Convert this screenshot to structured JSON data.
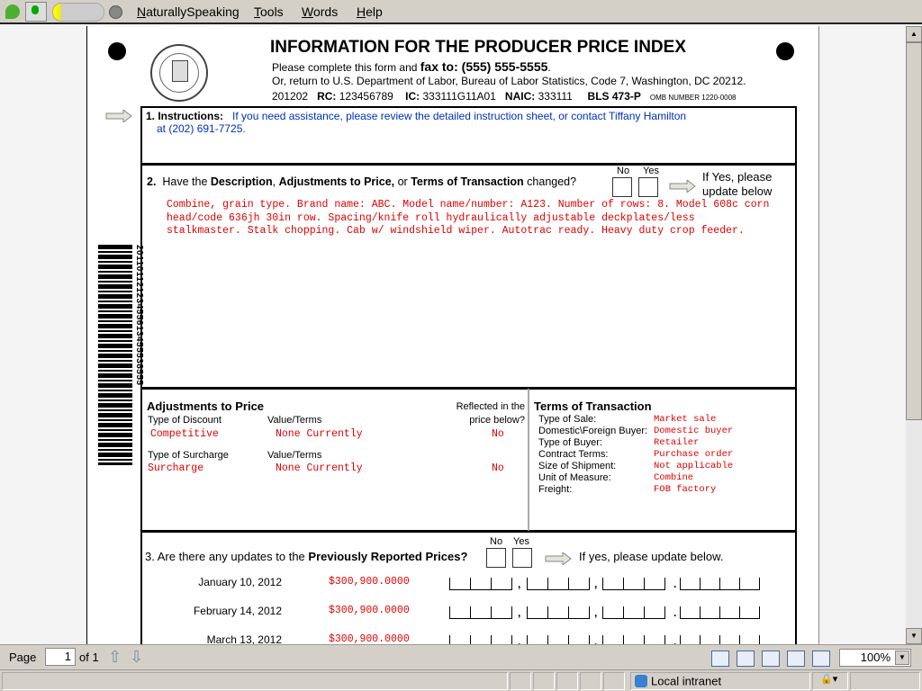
{
  "toolbar": {
    "menus": [
      {
        "letter": "N",
        "rest": "aturallySpeaking"
      },
      {
        "letter": "T",
        "rest": "ools"
      },
      {
        "letter": "W",
        "rest": "ords"
      },
      {
        "letter": "H",
        "rest": "elp"
      }
    ]
  },
  "form": {
    "title": "INFORMATION FOR THE PRODUCER PRICE INDEX",
    "fax_prefix": "Please complete this form and",
    "fax": "fax to: (555) 555-5555",
    "return_line": "Or, return to U.S. Department of Labor, Bureau of Labor Statistics, Code 7, Washington, DC 20212.",
    "id": "201202",
    "rc_label": "RC:",
    "rc": "123456789",
    "ic_label": "IC:",
    "ic": "333111G11A01",
    "naic_label": "NAIC:",
    "naic": "333111",
    "bls": "BLS 473-P",
    "omb": "OMB NUMBER 1220-0008",
    "seal_text": "DEPARTMENT OF LABOR UNITED STATES OF AMERICA",
    "barcode_text": "20110112123455613455538555",
    "s1": {
      "label": "1. Instructions:",
      "text": "If you need assistance, please review the detailed instruction sheet, or contact Tiffany Hamilton",
      "text2": "at (202) 691-7725."
    },
    "s2": {
      "num": "2.",
      "q1": "Have the ",
      "b1": "Description",
      ", ": ", ",
      "b2": "Adjustments to Price,",
      "q2": " or ",
      "b3": "Terms of Transaction",
      "q3": " changed?",
      "no": "No",
      "yes": "Yes",
      "ifyes": "If Yes, please",
      "ifyes2": "update below",
      "desc": [
        "Combine, grain type. Brand name: ABC. Model name/number: A123. Number of rows: 8. Model 608c corn",
        "head/code 636jh 30in row. Spacing/knife roll hydraulically adjustable deckplates/less",
        "stalkmaster. Stalk chopping. Cab w/ windshield wiper. Autotrac ready. Heavy duty crop feeder."
      ]
    },
    "adj": {
      "title": "Adjustments to Price",
      "reflected1": "Reflected in the",
      "reflected2": "price below?",
      "discount_label": "Type of Discount",
      "value_label": "Value/Terms",
      "discount": "Competitive",
      "discount_value": "None Currently",
      "discount_ref": "No",
      "surcharge_label": "Type of Surcharge",
      "surcharge": "Surcharge",
      "surcharge_value": "None Currently",
      "surcharge_ref": "No"
    },
    "terms": {
      "title": "Terms of Transaction",
      "rows": [
        {
          "k": "Type of Sale:",
          "v": "Market sale"
        },
        {
          "k": "Domestic\\Foreign Buyer:",
          "v": "Domestic buyer"
        },
        {
          "k": "Type of Buyer:",
          "v": "Retailer"
        },
        {
          "k": "Contract Terms:",
          "v": "Purchase order"
        },
        {
          "k": "Size of Shipment:",
          "v": "Not applicable"
        },
        {
          "k": "Unit of Measure:",
          "v": "Combine"
        },
        {
          "k": "Freight:",
          "v": "FOB factory"
        }
      ]
    },
    "s3": {
      "q1": "3. Are there any updates to the ",
      "b": "Previously Reported Prices?",
      "no": "No",
      "yes": "Yes",
      "ifyes": "If yes, please update below.",
      "rows": [
        {
          "date": "January 10, 2012",
          "price": "$300,900.0000"
        },
        {
          "date": "February 14, 2012",
          "price": "$300,900.0000"
        },
        {
          "date": "March 13, 2012",
          "price": "$300,900.0000"
        }
      ]
    }
  },
  "pagebar": {
    "page_label": "Page",
    "page": "1",
    "of": "of 1",
    "zoom": "100%"
  },
  "status": {
    "zone": "Local intranet"
  }
}
